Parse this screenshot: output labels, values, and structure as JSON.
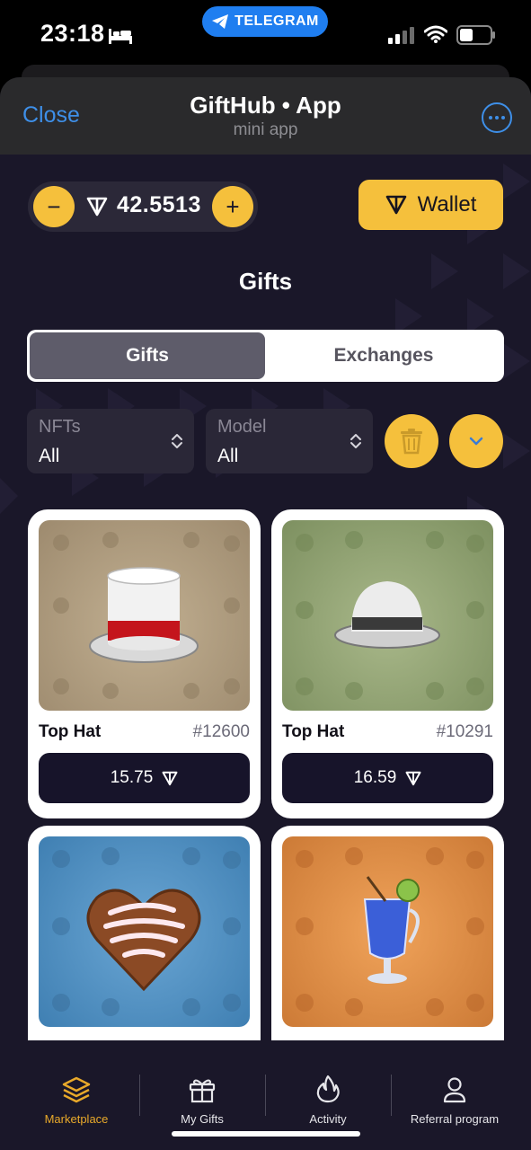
{
  "status_bar": {
    "time": "23:18",
    "pill_label": "TELEGRAM",
    "icons": [
      "bed-icon",
      "telegram-plane-icon",
      "signal-icon",
      "wifi-icon",
      "battery-icon"
    ]
  },
  "header": {
    "close_label": "Close",
    "title": "GiftHub • App",
    "subtitle": "mini app",
    "more_icon": "ellipsis-circle-icon"
  },
  "balance": {
    "value": "42.5513",
    "minus_label": "−",
    "plus_label": "+"
  },
  "wallet": {
    "label": "Wallet"
  },
  "page_title": "Gifts",
  "tabs": [
    {
      "label": "Gifts",
      "active": true
    },
    {
      "label": "Exchanges",
      "active": false
    }
  ],
  "filters": {
    "nfts": {
      "label": "NFTs",
      "value": "All"
    },
    "model": {
      "label": "Model",
      "value": "All"
    }
  },
  "cards": [
    {
      "name": "Top Hat",
      "number": "#12600",
      "price": "15.75",
      "bg": "#a89579"
    },
    {
      "name": "Top Hat",
      "number": "#10291",
      "price": "16.59",
      "bg": "#8a9d6a"
    },
    {
      "name": "",
      "number": "",
      "price": "",
      "bg": "#4f8fc0"
    },
    {
      "name": "",
      "number": "",
      "price": "",
      "bg": "#d58744"
    }
  ],
  "nav": [
    {
      "label": "Marketplace",
      "icon": "layers-icon",
      "active": true
    },
    {
      "label": "My Gifts",
      "icon": "gift-icon",
      "active": false
    },
    {
      "label": "Activity",
      "icon": "flame-icon",
      "active": false
    },
    {
      "label": "Referral program",
      "icon": "person-icon",
      "active": false
    }
  ],
  "colors": {
    "accent": "#f5c03c",
    "link": "#3e8fe8",
    "background": "#1a1729",
    "nav_active": "#e8a92a"
  }
}
